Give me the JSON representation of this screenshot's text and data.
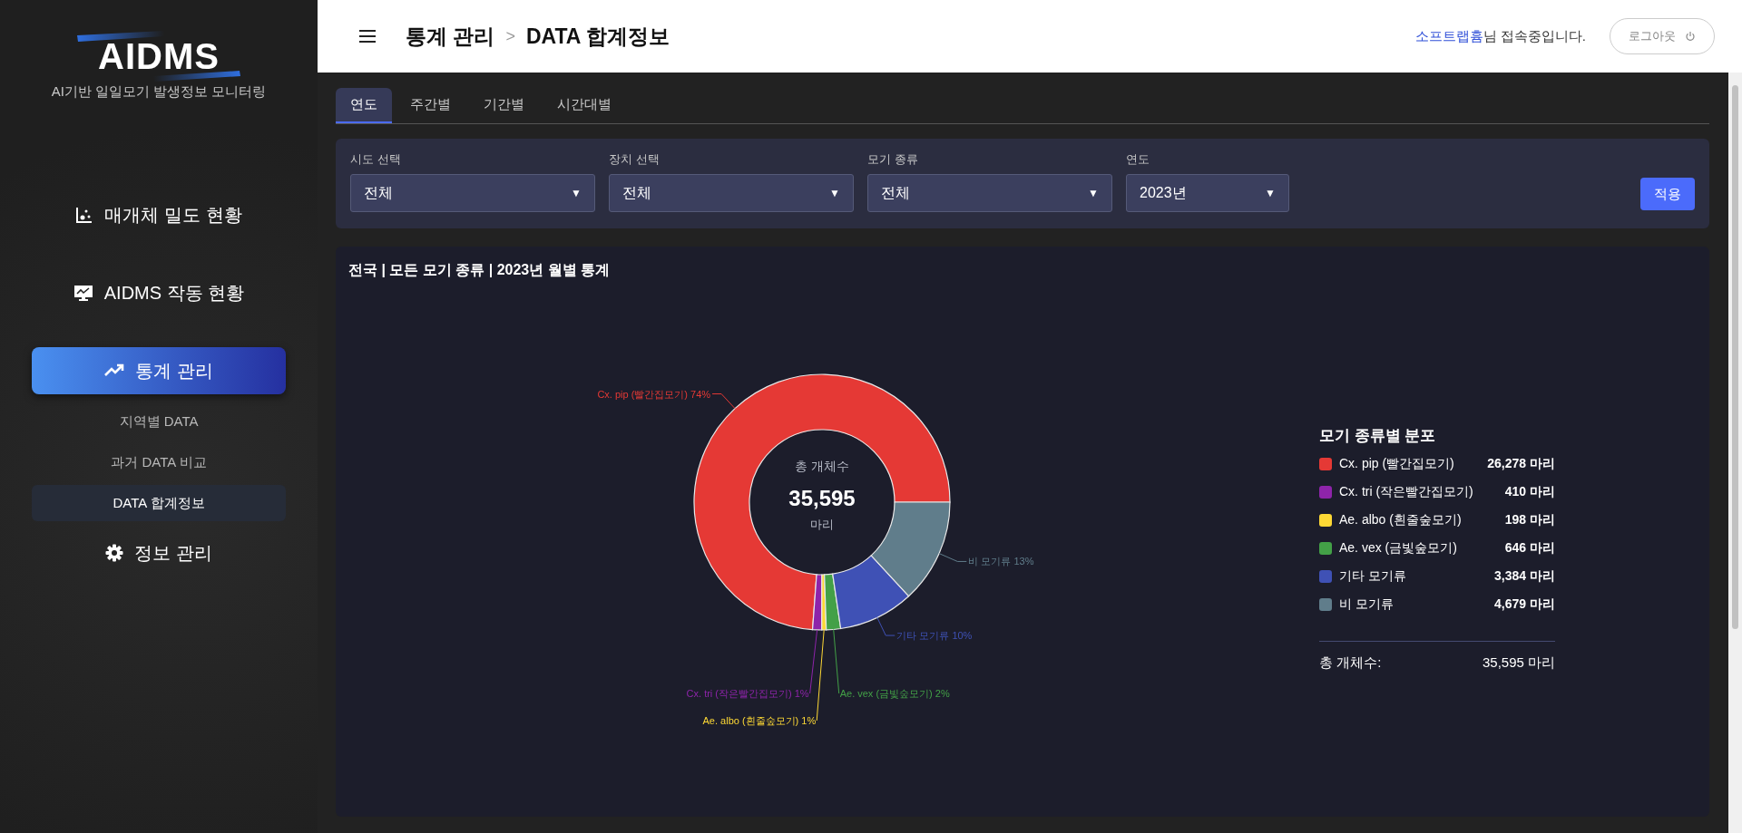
{
  "sidebar": {
    "logo": "AIDMS",
    "subtitle": "AI기반 일일모기 발생정보 모니터링",
    "nav": [
      {
        "label": "매개체 밀도 현황",
        "selected": false
      },
      {
        "label": "AIDMS 작동 현황",
        "selected": false
      },
      {
        "label": "통계 관리",
        "selected": true,
        "children": [
          {
            "label": "지역별 DATA",
            "selected": false
          },
          {
            "label": "과거 DATA 비교",
            "selected": false
          },
          {
            "label": "DATA 합계정보",
            "selected": true
          }
        ]
      },
      {
        "label": "정보 관리",
        "selected": false
      }
    ]
  },
  "header": {
    "breadcrumb": [
      "통계 관리",
      "DATA 합계정보"
    ],
    "separator": ">",
    "user_name": "소프트랩흄",
    "user_suffix": "님 접속중입니다.",
    "logout": "로그아웃"
  },
  "tabs": [
    {
      "label": "연도",
      "selected": true
    },
    {
      "label": "주간별",
      "selected": false
    },
    {
      "label": "기간별",
      "selected": false
    },
    {
      "label": "시간대별",
      "selected": false
    }
  ],
  "filters": [
    {
      "label": "시도 선택",
      "value": "전체",
      "caret": "▼"
    },
    {
      "label": "장치 선택",
      "value": "전체",
      "caret": "▼"
    },
    {
      "label": "모기 종류",
      "value": "전체",
      "caret": "▼"
    },
    {
      "label": "연도",
      "value": "2023년",
      "caret": "▼"
    }
  ],
  "apply": "적용",
  "stats": {
    "title": "전국 | 모든 모기 종류 | 2023년 월별 통계",
    "center": {
      "label": "총 개체수",
      "value": "35,595",
      "unit": "마리"
    },
    "chart_data": {
      "type": "donut",
      "categories": [
        "Cx. pip (빨간집모기)",
        "Cx. tri (작은빨간집모기)",
        "Ae. albo (흰줄숲모기)",
        "Ae. vex (금빛숲모기)",
        "기타 모기류",
        "비 모기류"
      ],
      "values": [
        73.82,
        1.15,
        0.56,
        1.81,
        9.51,
        13.15
      ],
      "colors": [
        "#e53935",
        "#8e24aa",
        "#fdd835",
        "#43a047",
        "#3f51b5",
        "#607d8b"
      ],
      "value_labels": [
        "74%",
        "1%",
        "1%",
        "2%",
        "10%",
        "13%"
      ]
    },
    "legend": {
      "title": "모기 종류별 분포",
      "items": [
        {
          "name": "Cx. pip (빨간집모기)",
          "count": "26,278 마리",
          "color": "#e53935"
        },
        {
          "name": "Cx. tri (작은빨간집모기)",
          "count": "410 마리",
          "color": "#8e24aa"
        },
        {
          "name": "Ae. albo (흰줄숲모기)",
          "count": "198 마리",
          "color": "#fdd835"
        },
        {
          "name": "Ae. vex (금빛숲모기)",
          "count": "646 마리",
          "color": "#43a047"
        },
        {
          "name": "기타 모기류",
          "count": "3,384 마리",
          "color": "#3f51b5"
        },
        {
          "name": "비 모기류",
          "count": "4,679 마리",
          "color": "#607d8b"
        }
      ],
      "total_label": "총 개체수:",
      "total_value": "35,595 마리"
    }
  }
}
